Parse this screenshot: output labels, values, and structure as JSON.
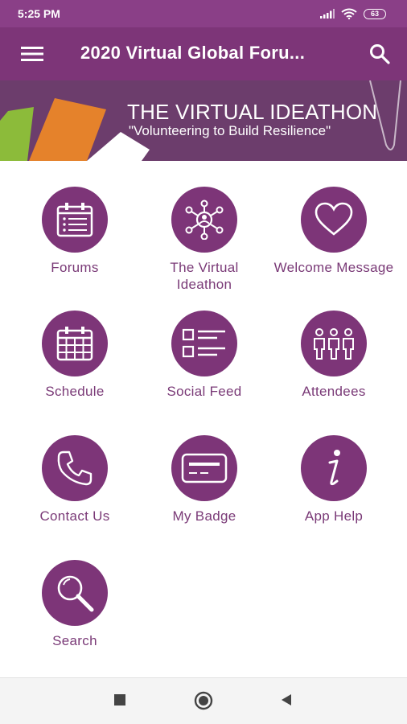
{
  "status_bar": {
    "time": "5:25 PM",
    "battery": "63"
  },
  "app_bar": {
    "title": "2020 Virtual Global Foru..."
  },
  "banner": {
    "title": "THE VIRTUAL IDEATHON",
    "subtitle": "\"Volunteering to Build Resilience\""
  },
  "colors": {
    "primary": "#7d3578",
    "status_bar": "#8a3f87",
    "label": "#7a3a77",
    "banner_bg": "#6c3d6c"
  },
  "menu": {
    "items": [
      {
        "label": "Forums",
        "icon": "calendar-list-icon"
      },
      {
        "label": "The Virtual Ideathon",
        "icon": "network-people-icon"
      },
      {
        "label": "Welcome Message",
        "icon": "heart-icon"
      },
      {
        "label": "Schedule",
        "icon": "calendar-grid-icon"
      },
      {
        "label": "Social Feed",
        "icon": "list-icon"
      },
      {
        "label": "Attendees",
        "icon": "people-icon"
      },
      {
        "label": "Contact Us",
        "icon": "phone-icon"
      },
      {
        "label": "My Badge",
        "icon": "badge-card-icon"
      },
      {
        "label": "App Help",
        "icon": "info-icon"
      },
      {
        "label": "Search",
        "icon": "magnifier-icon"
      }
    ]
  }
}
